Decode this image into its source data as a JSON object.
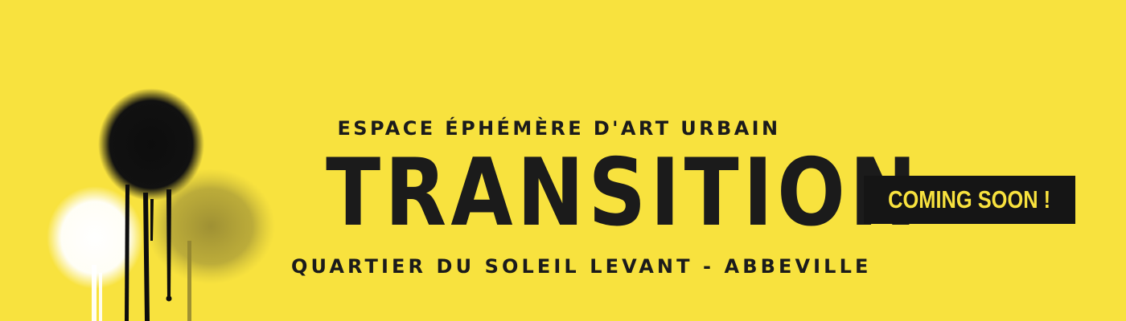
{
  "banner": {
    "tagline_top": "ESPACE ÉPHÉMÈRE D'ART URBAIN",
    "title": "TRANSITION",
    "tagline_bottom": "QUARTIER DU SOLEIL LEVANT - ABBEVILLE",
    "badge_label": "COMING SOON !"
  },
  "colors": {
    "background": "#f8e23e",
    "text": "#1b1b1b",
    "badge_background": "#151515",
    "badge_text": "#f8e23e",
    "spray_black": "#0d0d0d",
    "spray_white": "#ffffff",
    "spray_olive": "#a89a38"
  },
  "decoration": {
    "icon": "spray-paint-drips-icon"
  }
}
